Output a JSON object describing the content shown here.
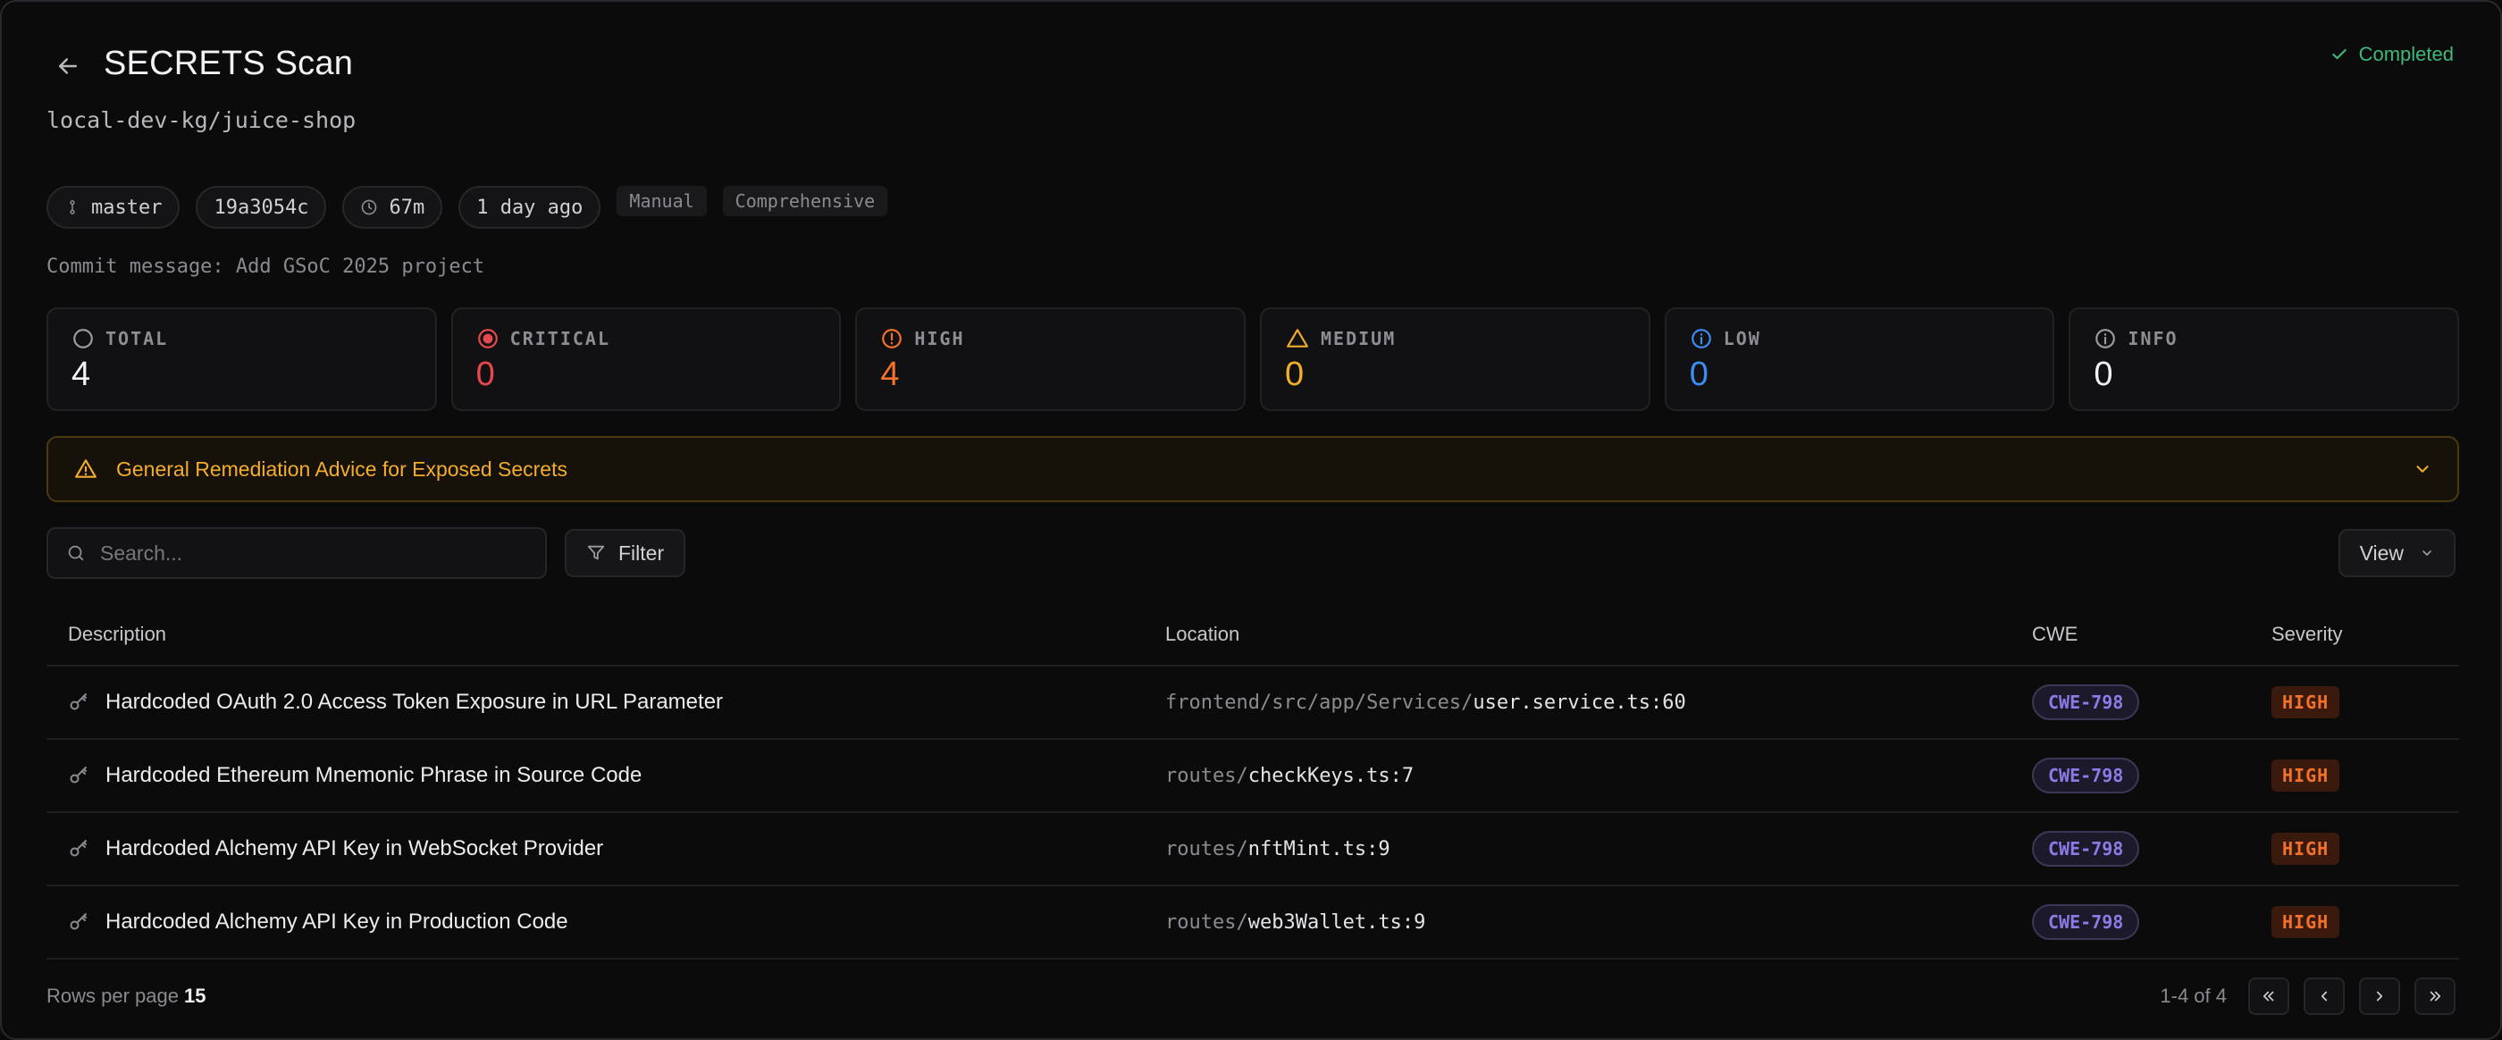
{
  "header": {
    "title": "SECRETS Scan",
    "repo": "local-dev-kg/juice-shop",
    "status": "Completed",
    "colors": {
      "status": "#3fb97a"
    }
  },
  "chips": {
    "branch": "master",
    "commit": "19a3054c",
    "duration": "67m",
    "time": "1 day ago",
    "tags": [
      "Manual",
      "Comprehensive"
    ]
  },
  "commit_message": "Commit message: Add GSoC 2025 project",
  "stats": [
    {
      "label": "TOTAL",
      "value": "4",
      "color": "#f2f2f4",
      "icon": "circle-icon"
    },
    {
      "label": "CRITICAL",
      "value": "0",
      "color": "#e5484d",
      "icon": "target-icon"
    },
    {
      "label": "HIGH",
      "value": "4",
      "color": "#f2722c",
      "icon": "alert-circle-icon"
    },
    {
      "label": "MEDIUM",
      "value": "0",
      "color": "#f2ad2c",
      "icon": "warning-triangle-icon"
    },
    {
      "label": "LOW",
      "value": "0",
      "color": "#3b8df2",
      "icon": "info-icon"
    },
    {
      "label": "INFO",
      "value": "0",
      "color": "#f2f2f4",
      "icon": "info-icon"
    }
  ],
  "advice": {
    "label": "General Remediation Advice for Exposed Secrets"
  },
  "toolbar": {
    "search_placeholder": "Search...",
    "filter_label": "Filter",
    "view_label": "View"
  },
  "table": {
    "columns": [
      "Description",
      "Location",
      "CWE",
      "Severity"
    ],
    "rows": [
      {
        "description": "Hardcoded OAuth 2.0 Access Token Exposure in URL Parameter",
        "dir": "frontend/src/app/Services/",
        "file": "user.service.ts:60",
        "cwe": "CWE-798",
        "severity": "HIGH"
      },
      {
        "description": "Hardcoded Ethereum Mnemonic Phrase in Source Code",
        "dir": "routes/",
        "file": "checkKeys.ts:7",
        "cwe": "CWE-798",
        "severity": "HIGH"
      },
      {
        "description": "Hardcoded Alchemy API Key in WebSocket Provider",
        "dir": "routes/",
        "file": "nftMint.ts:9",
        "cwe": "CWE-798",
        "severity": "HIGH"
      },
      {
        "description": "Hardcoded Alchemy API Key in Production Code",
        "dir": "routes/",
        "file": "web3Wallet.ts:9",
        "cwe": "CWE-798",
        "severity": "HIGH"
      }
    ]
  },
  "footer": {
    "rows_per_page_label": "Rows per page",
    "rows_per_page": "15",
    "range": "1-4 of 4"
  }
}
